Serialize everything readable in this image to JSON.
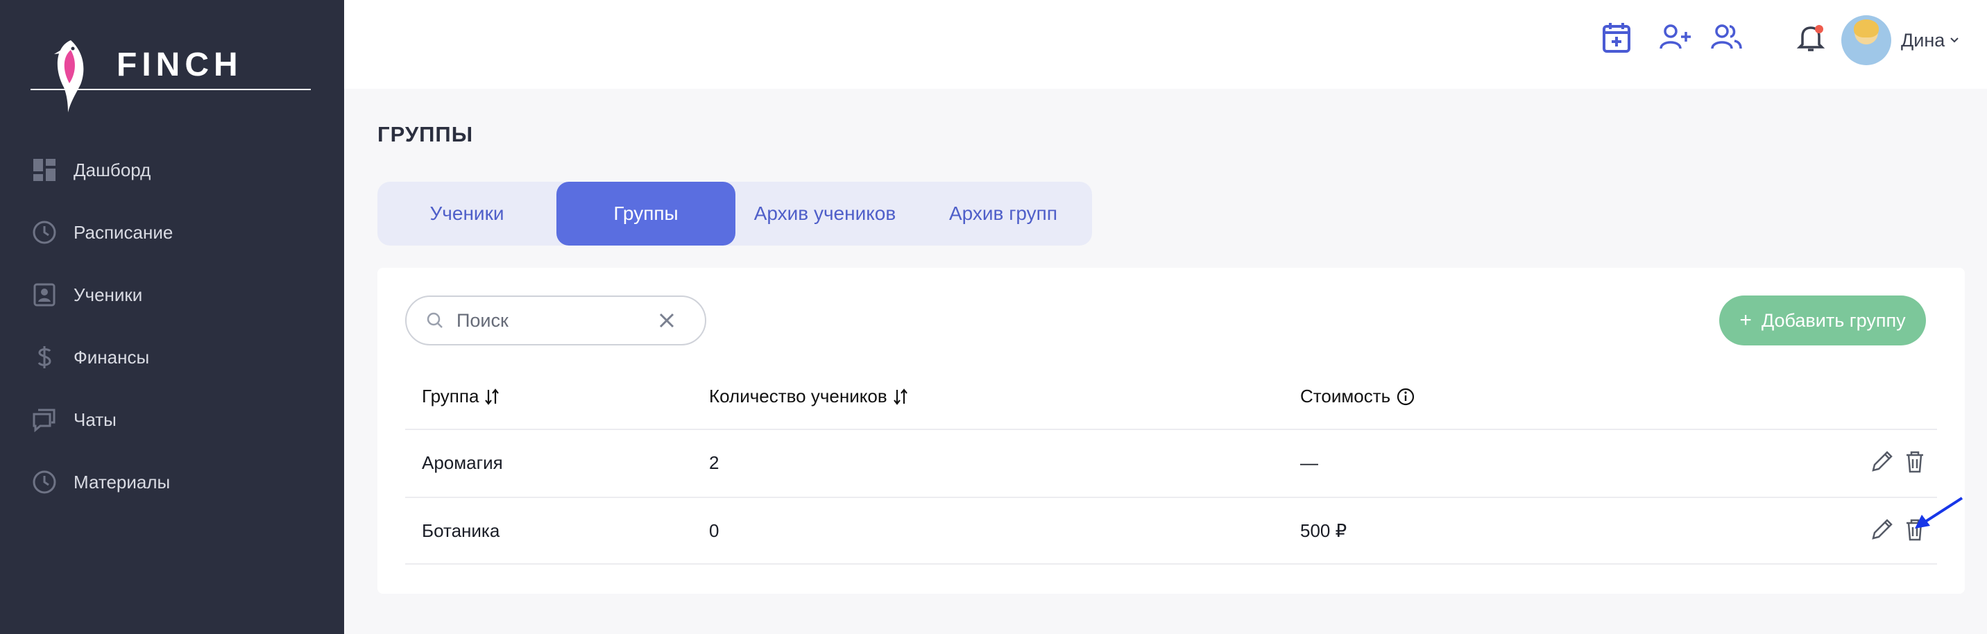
{
  "brand": {
    "name": "FINCH"
  },
  "sidebar": {
    "items": [
      {
        "label": "Дашборд",
        "icon": "dashboard-icon"
      },
      {
        "label": "Расписание",
        "icon": "clock-icon"
      },
      {
        "label": "Ученики",
        "icon": "student-badge-icon"
      },
      {
        "label": "Финансы",
        "icon": "dollar-icon"
      },
      {
        "label": "Чаты",
        "icon": "chat-icon"
      },
      {
        "label": "Материалы",
        "icon": "clock-icon"
      }
    ]
  },
  "header": {
    "icons": [
      "calendar-add-icon",
      "user-add-icon",
      "users-icon",
      "bell-icon"
    ],
    "user_name": "Дина",
    "notification_dot_color": "#ef5b4c"
  },
  "page": {
    "title": "ГРУППЫ",
    "tabs": [
      {
        "label": "Ученики",
        "active": false
      },
      {
        "label": "Группы",
        "active": true
      },
      {
        "label": "Архив учеников",
        "active": false
      },
      {
        "label": "Архив групп",
        "active": false
      }
    ]
  },
  "toolbar": {
    "search_placeholder": "Поиск",
    "add_group_label": "Добавить группу"
  },
  "table": {
    "columns": [
      "Группа",
      "Количество учеников",
      "Стоимость"
    ],
    "rows": [
      {
        "group": "Аромагия",
        "count": "2",
        "price": "—"
      },
      {
        "group": "Ботаника",
        "count": "0",
        "price": "500 ₽"
      }
    ]
  },
  "colors": {
    "sidebar_bg": "#2b2f3f",
    "accent": "#5a6ee0",
    "add_button": "#7cc79a",
    "header_icon": "#4a5bd4"
  }
}
